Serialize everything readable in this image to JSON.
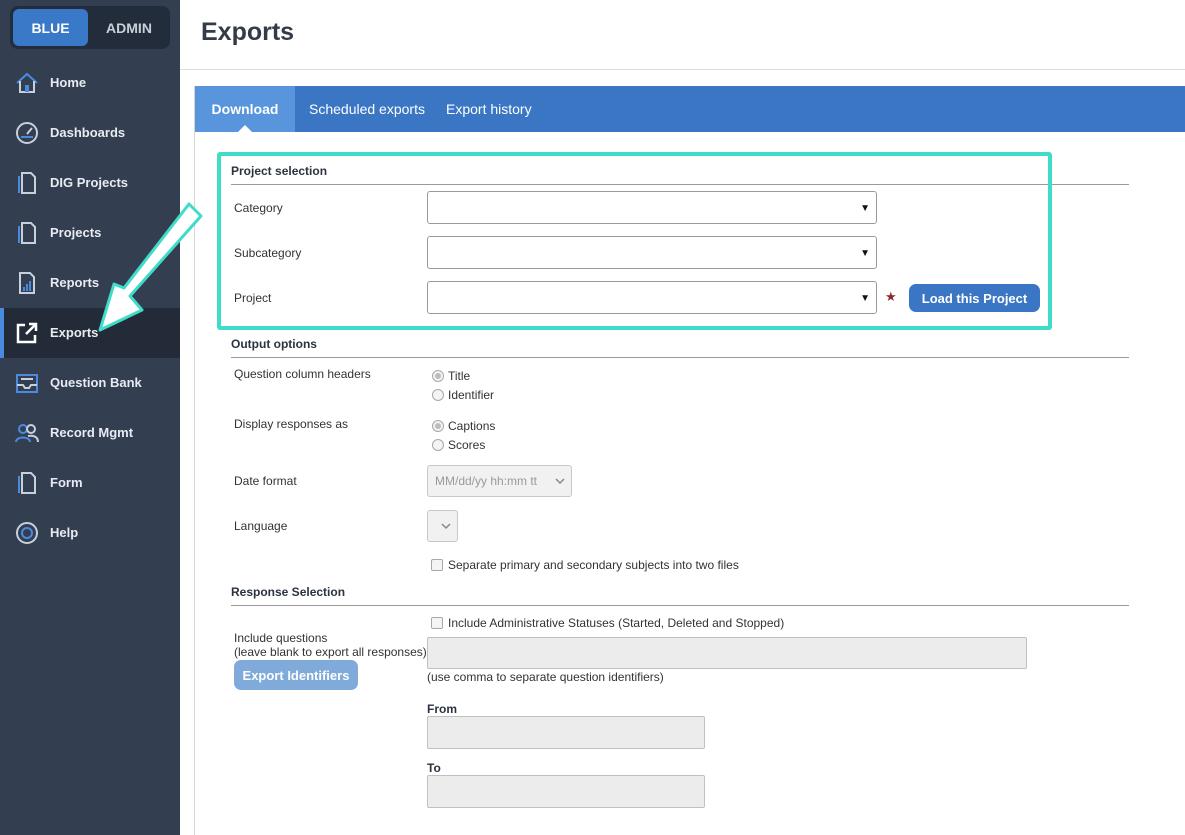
{
  "sidebar": {
    "toggle": {
      "blue_label": "BLUE",
      "admin_label": "ADMIN"
    },
    "items": [
      {
        "label": "Home",
        "icon": "home-icon"
      },
      {
        "label": "Dashboards",
        "icon": "dashboard-gauge-icon"
      },
      {
        "label": "DIG Projects",
        "icon": "document-icon"
      },
      {
        "label": "Projects",
        "icon": "document-icon"
      },
      {
        "label": "Reports",
        "icon": "report-chart-icon"
      },
      {
        "label": "Exports",
        "icon": "external-link-icon",
        "active": true
      },
      {
        "label": "Question Bank",
        "icon": "inbox-tray-icon"
      },
      {
        "label": "Record Mgmt",
        "icon": "users-icon"
      },
      {
        "label": "Form",
        "icon": "document-icon"
      },
      {
        "label": "Help",
        "icon": "lifebuoy-icon"
      }
    ]
  },
  "header": {
    "title": "Exports"
  },
  "tabs": [
    {
      "label": "Download",
      "active": true
    },
    {
      "label": "Scheduled exports"
    },
    {
      "label": "Export history"
    }
  ],
  "project_selection": {
    "heading": "Project selection",
    "category_label": "Category",
    "subcategory_label": "Subcategory",
    "project_label": "Project",
    "required_mark": "★",
    "dropdown_arrow": "▼",
    "load_button": "Load this Project"
  },
  "output_options": {
    "heading": "Output options",
    "column_headers_label": "Question column headers",
    "column_headers_options": [
      "Title",
      "Identifier"
    ],
    "display_label": "Display responses as",
    "display_options": [
      "Captions",
      "Scores"
    ],
    "date_format_label": "Date format",
    "date_format_value": "MM/dd/yy hh:mm tt",
    "language_label": "Language",
    "language_value": "",
    "separate_files_label": "Separate primary and secondary subjects into two files"
  },
  "response_selection": {
    "heading": "Response Selection",
    "admin_statuses_label": "Include Administrative Statuses (Started, Deleted and Stopped)",
    "include_questions_label": "Include questions",
    "include_questions_hint": "(leave blank to export all responses)",
    "comma_hint": "(use comma to separate question identifiers)",
    "export_identifiers_button": "Export Identifiers",
    "from_label": "From",
    "to_label": "To"
  },
  "colors": {
    "sidebar_bg": "#333e51",
    "tabbar_bg": "#3a76c4",
    "active_tab": "#5895dc",
    "highlight": "#3fdcc9",
    "required": "#8b2a2a"
  }
}
